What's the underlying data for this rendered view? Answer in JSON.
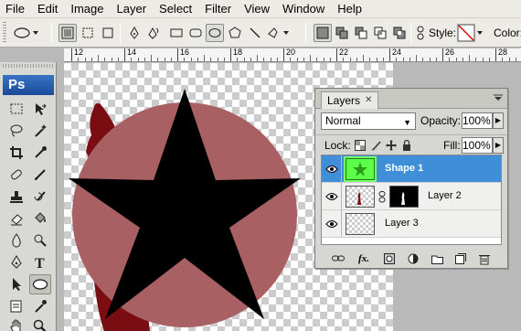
{
  "menu": [
    "File",
    "Edit",
    "Image",
    "Layer",
    "Select",
    "Filter",
    "View",
    "Window",
    "Help"
  ],
  "options_bar": {
    "style_label": "Style:",
    "color_label": "Color:"
  },
  "ruler": {
    "labels": [
      "12",
      "14",
      "16",
      "18",
      "20",
      "22",
      "24",
      "26",
      "28"
    ]
  },
  "tools": {
    "logo": "Ps"
  },
  "canvas": {
    "circle_color": "#a96062",
    "star_color": "#000000",
    "cloth_color": "#7a0d12"
  },
  "layers_panel": {
    "tab_label": "Layers",
    "blend_mode": "Normal",
    "opacity_label": "Opacity:",
    "opacity_value": "100%",
    "lock_label": "Lock:",
    "fill_label": "Fill:",
    "fill_value": "100%",
    "layers": [
      {
        "name": "Shape 1",
        "selected": true,
        "visible": true
      },
      {
        "name": "Layer 2",
        "selected": false,
        "visible": true
      },
      {
        "name": "Layer 3",
        "selected": false,
        "visible": true
      }
    ]
  },
  "colors": {
    "selection_blue": "#3f8fd8",
    "ps_logo_blue": "#2a5db0"
  }
}
